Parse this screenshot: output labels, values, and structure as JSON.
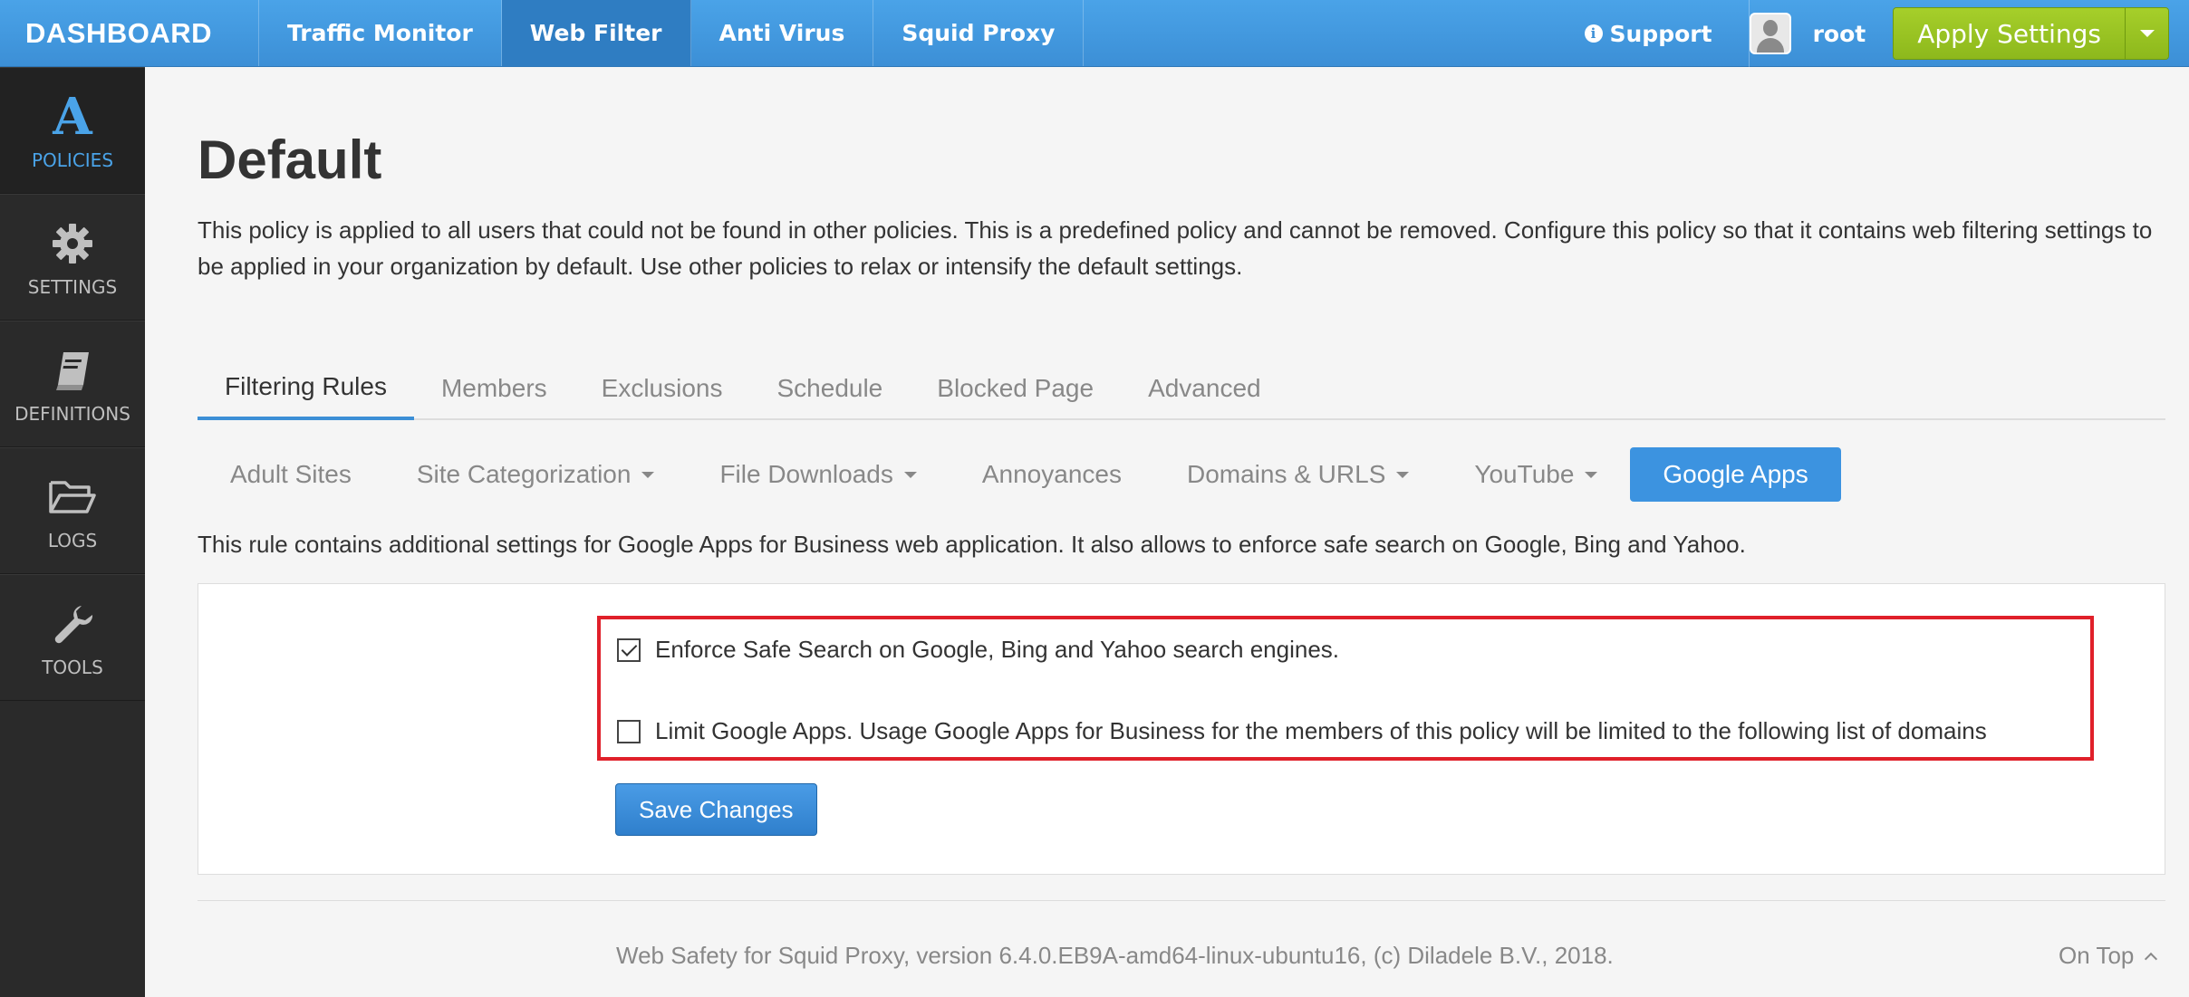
{
  "topnav": {
    "brand": "DASHBOARD",
    "links": [
      {
        "label": "Traffic Monitor"
      },
      {
        "label": "Web Filter"
      },
      {
        "label": "Anti Virus"
      },
      {
        "label": "Squid Proxy"
      }
    ],
    "support": "Support",
    "user": "root",
    "apply": "Apply Settings"
  },
  "sidebar": {
    "items": [
      {
        "label": "POLICIES",
        "glyph": "A"
      },
      {
        "label": "SETTINGS"
      },
      {
        "label": "DEFINITIONS"
      },
      {
        "label": "LOGS"
      },
      {
        "label": "TOOLS"
      }
    ]
  },
  "page": {
    "title": "Default",
    "description": "This policy is applied to all users that could not be found in other policies. This is a predefined policy and cannot be removed. Configure this policy so that it contains web filtering settings to be applied in your organization by default. Use other policies to relax or intensify the default settings."
  },
  "tabs": [
    {
      "label": "Filtering Rules"
    },
    {
      "label": "Members"
    },
    {
      "label": "Exclusions"
    },
    {
      "label": "Schedule"
    },
    {
      "label": "Blocked Page"
    },
    {
      "label": "Advanced"
    }
  ],
  "subtabs": [
    {
      "label": "Adult Sites"
    },
    {
      "label": "Site Categorization"
    },
    {
      "label": "File Downloads"
    },
    {
      "label": "Annoyances"
    },
    {
      "label": "Domains & URLS"
    },
    {
      "label": "YouTube"
    },
    {
      "label": "Google Apps"
    }
  ],
  "rule": {
    "description": "This rule contains additional settings for Google Apps for Business web application. It also allows to enforce safe search on Google, Bing and Yahoo.",
    "checkboxes": [
      {
        "label": "Enforce Safe Search on Google, Bing and Yahoo search engines.",
        "checked": true
      },
      {
        "label": "Limit Google Apps. Usage Google Apps for Business for the members of this policy will be limited to the following list of domains",
        "checked": false
      }
    ],
    "save": "Save Changes"
  },
  "footer": {
    "text": "Web Safety for Squid Proxy, version 6.4.0.EB9A-amd64-linux-ubuntu16, (c) Diladele B.V., 2018.",
    "ontop": "On Top"
  },
  "colors": {
    "accent": "#3c8fd6",
    "apply": "#9cc625",
    "highlight": "#e0202a"
  }
}
